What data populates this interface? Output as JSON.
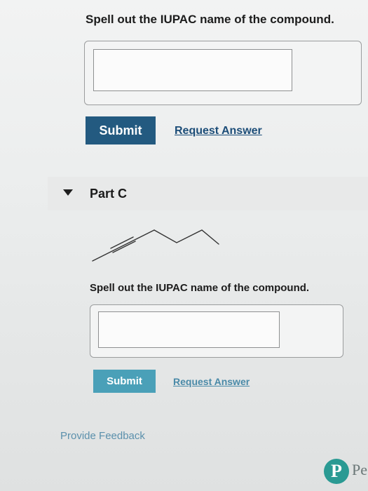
{
  "part_b": {
    "prompt": "Spell out the IUPAC name of the compound.",
    "answer_value": "",
    "submit_label": "Submit",
    "request_label": "Request Answer"
  },
  "part_c": {
    "title": "Part C",
    "prompt": "Spell out the IUPAC name of the compound.",
    "answer_value": "",
    "submit_label": "Submit",
    "request_label": "Request Answer"
  },
  "footer": {
    "feedback_label": "Provide Feedback",
    "logo_letter": "P",
    "logo_text": "Pe"
  },
  "colors": {
    "submit_dark": "#235a80",
    "submit_light": "#4aa0b8",
    "link": "#1c4d78",
    "logo": "#2a9a93"
  }
}
